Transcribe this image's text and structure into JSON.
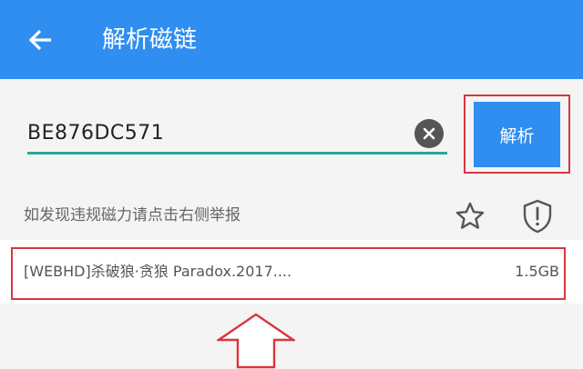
{
  "appbar": {
    "title": "解析磁链",
    "back_icon": "arrow-left-icon",
    "color": "#2f8ef0"
  },
  "search": {
    "value": "BE876DC571",
    "clear_icon": "close-circle-icon",
    "submit_label": "解析",
    "underline_color": "#26a69a"
  },
  "notice": {
    "text": "如发现违规磁力请点击右侧举报",
    "favorite_icon": "star-outline-icon",
    "report_icon": "shield-alert-icon"
  },
  "results": [
    {
      "name": "[WEBHD]杀破狼·贪狼 Paradox.2017....",
      "size": "1.5GB"
    }
  ],
  "annotation": {
    "highlight_color": "#d9363e",
    "arrow_icon": "arrow-up-outline-icon"
  }
}
